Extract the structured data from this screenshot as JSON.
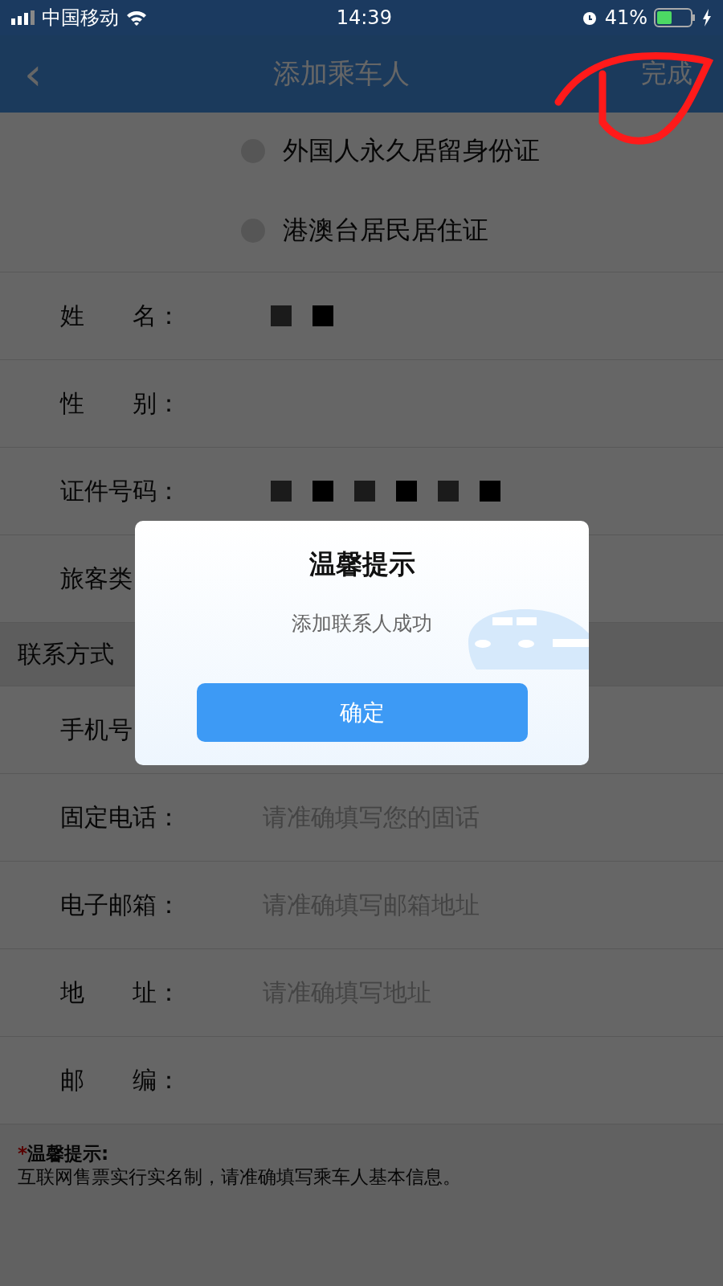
{
  "status_bar": {
    "carrier": "中国移动",
    "time": "14:39",
    "battery": "41%"
  },
  "nav": {
    "back": "‹",
    "title": "添加乘车人",
    "action": "完成"
  },
  "id_types": [
    {
      "label": "外国人永久居留身份证",
      "selected": false
    },
    {
      "label": "港澳台居民居住证",
      "selected": false
    }
  ],
  "fields": [
    {
      "label": "姓　　名：",
      "kind": "masked_name"
    },
    {
      "label": "性　　别：",
      "kind": "empty"
    },
    {
      "label": "证件号码：",
      "kind": "masked_id"
    },
    {
      "label": "旅客类",
      "kind": "empty"
    }
  ],
  "contact_section": "联系方式",
  "contact_fields": [
    {
      "label": "手机号",
      "kind": "empty"
    },
    {
      "label": "固定电话：",
      "kind": "input",
      "placeholder": "请准确填写您的固话"
    },
    {
      "label": "电子邮箱：",
      "kind": "input",
      "placeholder": "请准确填写邮箱地址"
    },
    {
      "label": "地　　址：",
      "kind": "input",
      "placeholder": "请准确填写地址"
    },
    {
      "label": "邮　　编：",
      "kind": "empty"
    }
  ],
  "hint": {
    "mark": "*",
    "title": "温馨提示:",
    "text": "互联网售票实行实名制，请准确填写乘车人基本信息。"
  },
  "dialog": {
    "title": "温馨提示",
    "message": "添加联系人成功",
    "button": "确定"
  }
}
